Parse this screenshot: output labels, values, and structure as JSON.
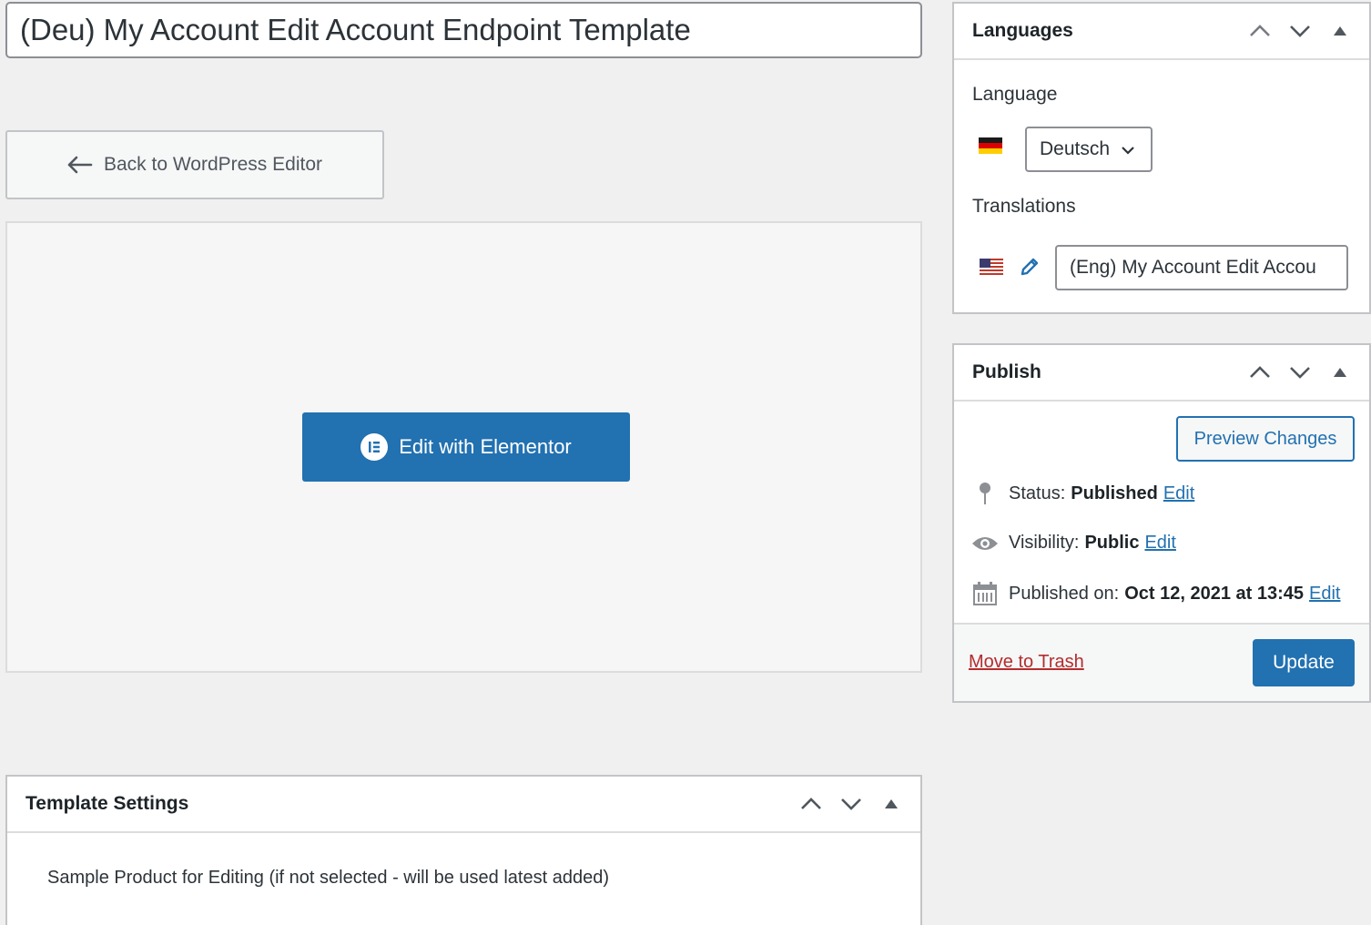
{
  "title": "(Deu) My Account Edit Account Endpoint Template",
  "back_button": "Back to WordPress Editor",
  "elementor_button": "Edit with Elementor",
  "languages_box": {
    "title": "Languages",
    "language_label": "Language",
    "language_value": "Deutsch",
    "translations_label": "Translations",
    "translation_value": "(Eng) My Account Edit Accou"
  },
  "publish_box": {
    "title": "Publish",
    "preview_button": "Preview Changes",
    "status_label": "Status:",
    "status_value": "Published",
    "visibility_label": "Visibility:",
    "visibility_value": "Public",
    "published_label": "Published on:",
    "published_value": "Oct 12, 2021 at 13:45",
    "edit_link": "Edit",
    "trash_link": "Move to Trash",
    "update_button": "Update"
  },
  "template_settings": {
    "title": "Template Settings",
    "sample_label": "Sample Product for Editing (if not selected - will be used latest added)"
  },
  "colors": {
    "accent": "#2271b1",
    "trash": "#b32d2e",
    "background": "#f0f0f1"
  },
  "icons": [
    "arrow-left-icon",
    "elementor-logo-icon",
    "chevron-up-icon",
    "chevron-down-icon",
    "triangle-up-icon",
    "flag-de-icon",
    "flag-us-icon",
    "pencil-icon",
    "pin-icon",
    "eye-icon",
    "calendar-icon"
  ]
}
